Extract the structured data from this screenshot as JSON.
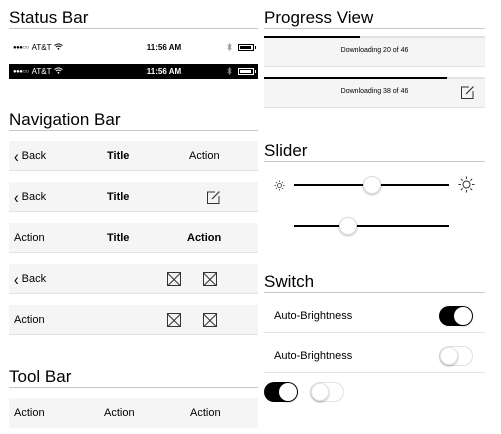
{
  "status_section": {
    "title": "Status Bar",
    "bars": [
      {
        "carrier": "AT&T",
        "signal": "●●●○○",
        "time": "11:56 AM",
        "theme": "light"
      },
      {
        "carrier": "AT&T",
        "signal": "●●●○○",
        "time": "11:56 AM",
        "theme": "dark"
      }
    ]
  },
  "nav_section": {
    "title": "Navigation Bar",
    "bars": [
      {
        "left": "Back",
        "center": "Title",
        "right": "Action"
      },
      {
        "left": "Back",
        "center": "Title",
        "right_icon": "compose-icon"
      },
      {
        "left": "Action",
        "center": "Title",
        "right": "Action"
      },
      {
        "left": "Back",
        "icons": [
          "placeholder-icon",
          "placeholder-icon"
        ]
      },
      {
        "left": "Action",
        "icons": [
          "placeholder-icon",
          "placeholder-icon"
        ]
      }
    ]
  },
  "toolbar_section": {
    "title": "Tool Bar",
    "items": [
      "Action",
      "Action",
      "Action"
    ]
  },
  "progress_section": {
    "title": "Progress View",
    "items": [
      {
        "label": "Downloading 20 of 46",
        "progress": 0.435
      },
      {
        "label": "Downloading 38 of 46",
        "progress": 0.826,
        "icon": "compose-icon"
      }
    ]
  },
  "slider_section": {
    "title": "Slider",
    "sliders": [
      {
        "value": 0.5,
        "min_icon": "brightness-low-icon",
        "max_icon": "brightness-high-icon"
      },
      {
        "value": 0.35
      }
    ]
  },
  "switch_section": {
    "title": "Switch",
    "rows": [
      {
        "label": "Auto-Brightness",
        "on": true
      },
      {
        "label": "Auto-Brightness",
        "on": false
      }
    ],
    "standalone": [
      {
        "on": true
      },
      {
        "on": false
      }
    ]
  },
  "colors": {
    "bar_bg": "#f5f5f5",
    "rule": "#c8c8c8",
    "accent": "#000000"
  }
}
